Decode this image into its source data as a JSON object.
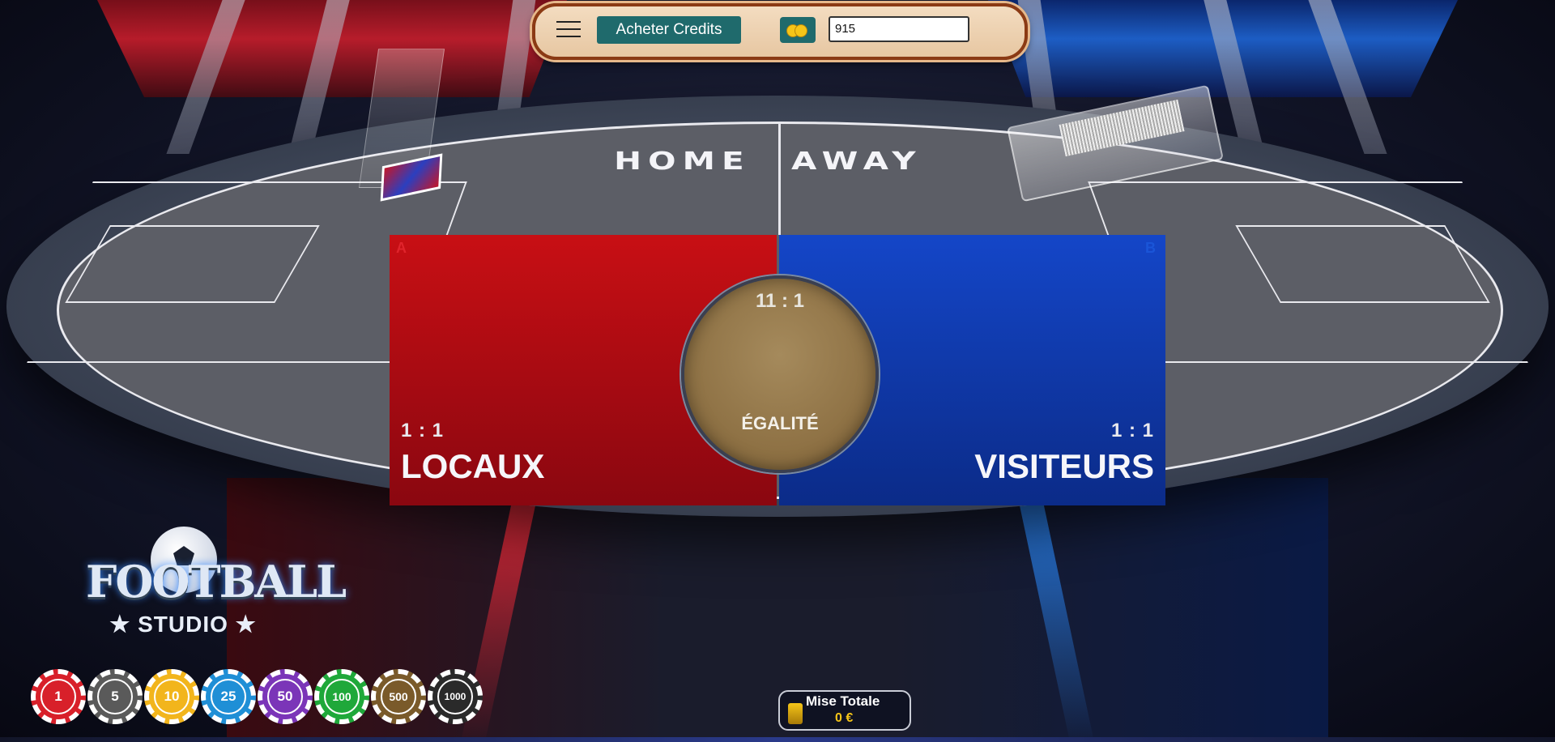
{
  "topbar": {
    "buy_label": "Acheter Credits",
    "credits": "915"
  },
  "table": {
    "home_label": "HOME",
    "away_label": "AWAY",
    "corner_a": "A",
    "corner_b": "B"
  },
  "bets": {
    "home": {
      "odds": "1 : 1",
      "name": "LOCAUX"
    },
    "draw": {
      "odds": "11 : 1",
      "name": "ÉGALITÉ"
    },
    "away": {
      "odds": "1 : 1",
      "name": "VISITEURS"
    }
  },
  "logo": {
    "word": "FOOTBALL",
    "sub": "★ STUDIO ★"
  },
  "chips": [
    {
      "value": "1",
      "color": "#d8202a"
    },
    {
      "value": "5",
      "color": "#5a5a5a"
    },
    {
      "value": "10",
      "color": "#f2b51c"
    },
    {
      "value": "25",
      "color": "#1f8fd6"
    },
    {
      "value": "50",
      "color": "#7b35b8"
    },
    {
      "value": "100",
      "color": "#1fa83a"
    },
    {
      "value": "500",
      "color": "#7a5a2a"
    },
    {
      "value": "1000",
      "color": "#2a2a2a"
    }
  ],
  "total": {
    "label": "Mise Totale",
    "value": "0 €"
  },
  "colors": {
    "home": "#c80f14",
    "away": "#1446c8",
    "draw": "#a58a5c",
    "buy": "#1f6a6c"
  }
}
